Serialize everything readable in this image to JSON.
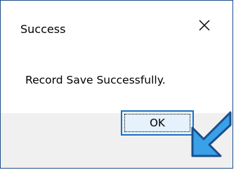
{
  "dialog": {
    "title": "Success",
    "message": "Record Save Successfully.",
    "ok_label": "OK"
  },
  "icons": {
    "close": "close-icon",
    "pointer": "arrow-pointer-icon"
  },
  "colors": {
    "button_border": "#1f6fc5",
    "button_fill": "#e5f1fb",
    "arrow_fill": "#3aa0e8",
    "arrow_outline": "#1b4f8a",
    "footer": "#f0f0f0",
    "window_border": "#1e4f8a"
  }
}
